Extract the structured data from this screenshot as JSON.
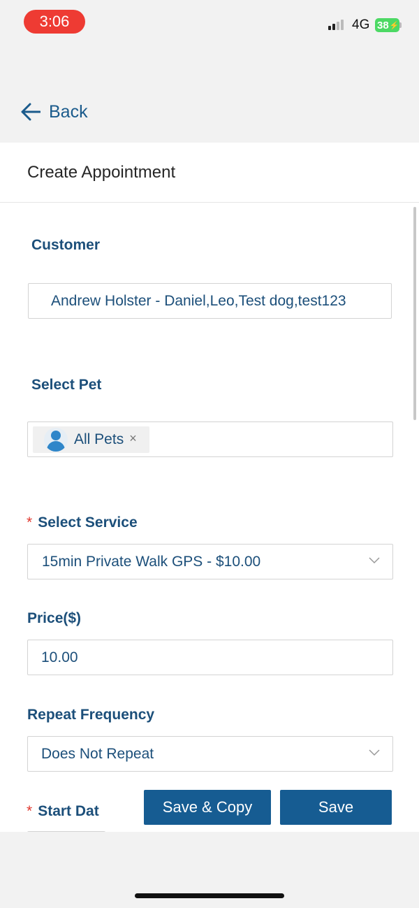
{
  "status": {
    "time": "3:06",
    "network": "4G",
    "battery": "38"
  },
  "nav": {
    "back_label": "Back"
  },
  "page": {
    "title": "Create Appointment"
  },
  "form": {
    "customer": {
      "label": "Customer",
      "value": "Andrew Holster - Daniel,Leo,Test dog,test123"
    },
    "pet": {
      "label": "Select Pet",
      "chip_label": "All Pets",
      "chip_remove": "×"
    },
    "service": {
      "required_mark": "*",
      "label": "Select Service",
      "value": "15min Private Walk GPS - $10.00"
    },
    "price": {
      "label": "Price($)",
      "value": "10.00"
    },
    "repeat": {
      "label": "Repeat Frequency",
      "value": "Does Not Repeat"
    },
    "start_date": {
      "required_mark": "*",
      "label": "Start Dat"
    }
  },
  "actions": {
    "save_copy_label": "Save & Copy",
    "save_label": "Save"
  },
  "colors": {
    "accent": "#165c92",
    "label": "#1c4f7a",
    "required": "#e0382e",
    "time_pill": "#ee3b33",
    "battery": "#4cd964"
  },
  "icons": [
    "back-arrow-icon",
    "user-avatar-icon",
    "close-icon",
    "chevron-down-icon",
    "signal-icon",
    "battery-icon"
  ]
}
